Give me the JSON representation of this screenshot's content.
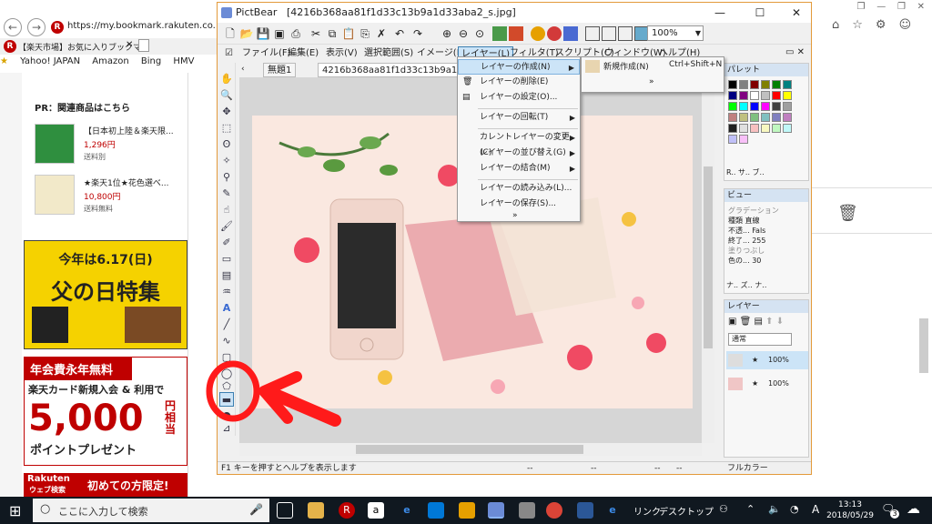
{
  "browser": {
    "url": "https://my.bookmark.rakuten.co.jp/?l-id=",
    "tab_title": "【楽天市場】お気に入りブックマ...",
    "favorites": [
      "Yahoo! JAPAN",
      "Amazon",
      "Bing",
      "HMV"
    ],
    "pr_heading": "PR：関連商品はこちら",
    "products": [
      {
        "title": "【日本初上陸＆楽天限...",
        "price": "1,296円",
        "shipping": "送料別"
      },
      {
        "title": "★楽天1位★花色選べ...",
        "price": "10,800円",
        "shipping": "送料無料"
      }
    ],
    "banner1": {
      "line1": "今年は6.17(日)",
      "line2": "父の日特集"
    },
    "banner2": {
      "line1": "年会費永年無料",
      "line2": "楽天カード新規入会 & 利用で",
      "line3": "5,000",
      "line3b": "円相当",
      "line4": "ポイントプレゼント"
    },
    "banner3": {
      "brand": "Rakuten",
      "sub": "ウェブ検索",
      "text": "初めての方限定!"
    }
  },
  "app": {
    "name": "PictBear",
    "file": "[4216b368aa81f1d33c13b9a1d33aba2_s.jpg]",
    "zoom": "100%",
    "menus": [
      "ファイル(F)",
      "編集(E)",
      "表示(V)",
      "選択範囲(S)",
      "イメージ(I)",
      "レイヤー(L)",
      "フィルタ(T)",
      "スクリプト(C)",
      "ウィンドウ(W)",
      "ヘルプ(H)"
    ],
    "doc_tabs": [
      "無題1",
      "4216b368aa81f1d33c13b9a1d13ab"
    ],
    "layer_menu": [
      "レイヤーの作成(N)",
      "レイヤーの削除(E)",
      "レイヤーの設定(O)...",
      "レイヤーの回転(T)",
      "カレントレイヤーの変更(C)",
      "レイヤーの並び替え(G)",
      "レイヤーの結合(M)",
      "レイヤーの読み込み(L)...",
      "レイヤーの保存(S)...",
      "»"
    ],
    "submenu": {
      "item": "新規作成(N)",
      "shortcut": "Ctrl+Shift+N",
      "more": "»"
    },
    "panels": {
      "palette": {
        "title": "パレット",
        "tabs": [
          "R..",
          "サ..",
          "ブ.."
        ]
      },
      "view": {
        "title": "ビュー",
        "rows": [
          [
            "グラデーション",
            ""
          ],
          [
            "種類",
            "直線"
          ],
          [
            "不透...",
            "Fals"
          ],
          [
            "終了...",
            "255"
          ],
          [
            "塗りつぶし",
            ""
          ],
          [
            "色の...",
            "30"
          ]
        ],
        "tabs": [
          "ナ..",
          "ズ..",
          "ナ.."
        ]
      },
      "layer": {
        "title": "レイヤー",
        "mode": "通常",
        "layers": [
          {
            "opacity": "100%"
          },
          {
            "opacity": "100%"
          }
        ]
      }
    },
    "status": {
      "hint": "F1 キーを押すとヘルプを表示します",
      "a": "--",
      "b": "--",
      "c": "--",
      "d": "--",
      "color": "フルカラー"
    }
  },
  "taskbar": {
    "search_placeholder": "ここに入力して検索",
    "links": "リンク",
    "desktop": "デスクトップ",
    "ime": "A",
    "time": "13:13",
    "date": "2018/05/29",
    "notifications": "3"
  },
  "colors": {
    "accent_red": "#bf0000",
    "annotation_red": "#ff1a1a",
    "menu_highlight": "#cce4f7"
  }
}
